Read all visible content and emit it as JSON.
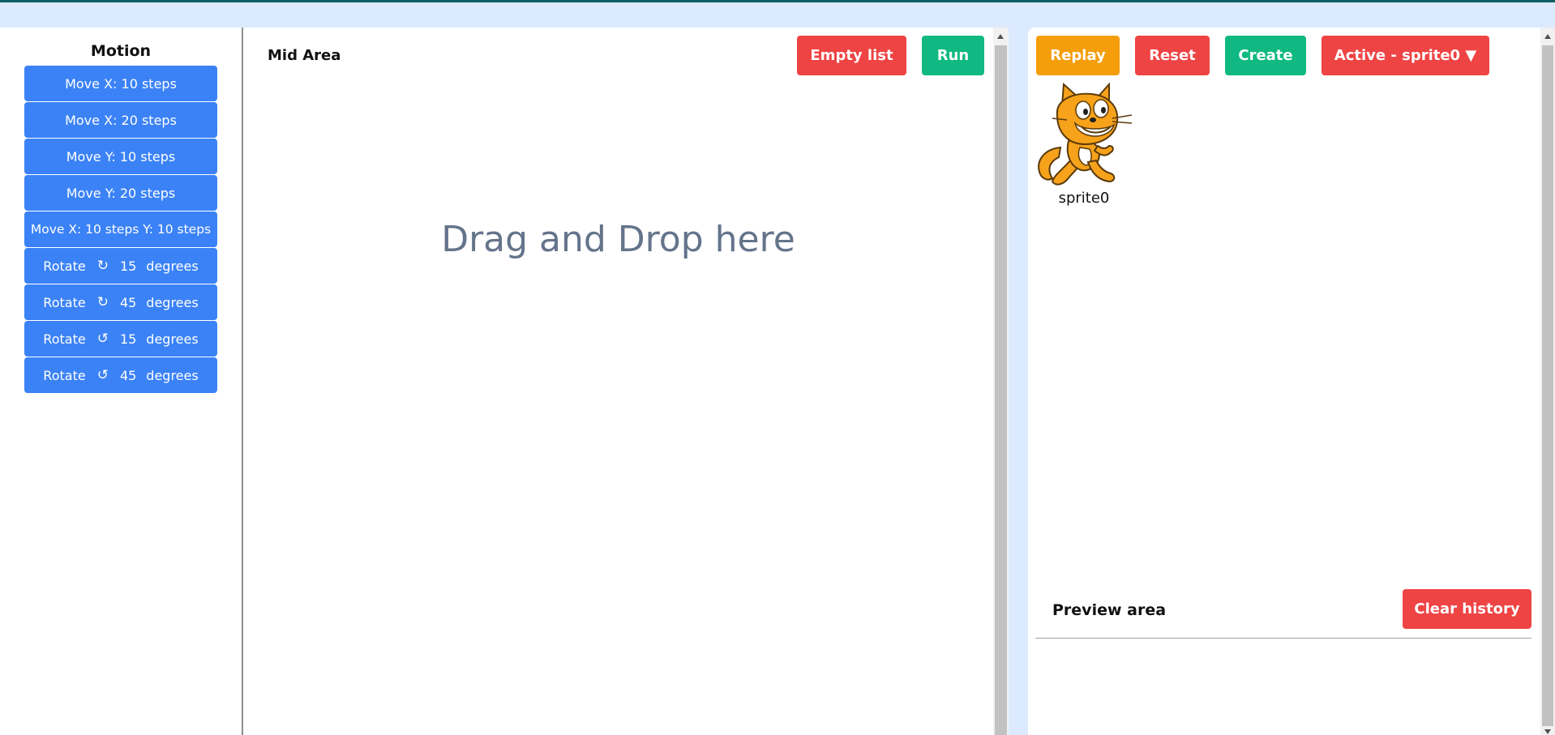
{
  "sidebar": {
    "title": "Motion",
    "blocks": [
      {
        "label": "Move X: 10 steps"
      },
      {
        "label": "Move X: 20 steps"
      },
      {
        "label": "Move Y: 10 steps"
      },
      {
        "label": "Move Y: 20 steps"
      },
      {
        "label": "Move X: 10 steps Y: 10 steps"
      },
      {
        "prefix": "Rotate",
        "icon": "rotate-clockwise-icon",
        "glyph": "↻",
        "value": "15",
        "suffix": "degrees"
      },
      {
        "prefix": "Rotate",
        "icon": "rotate-clockwise-icon",
        "glyph": "↻",
        "value": "45",
        "suffix": "degrees"
      },
      {
        "prefix": "Rotate",
        "icon": "rotate-counterclockwise-icon",
        "glyph": "↺",
        "value": "15",
        "suffix": "degrees"
      },
      {
        "prefix": "Rotate",
        "icon": "rotate-counterclockwise-icon",
        "glyph": "↺",
        "value": "45",
        "suffix": "degrees"
      }
    ]
  },
  "mid": {
    "title": "Mid Area",
    "empty_list_label": "Empty list",
    "run_label": "Run",
    "placeholder": "Drag and Drop here"
  },
  "preview": {
    "replay_label": "Replay",
    "reset_label": "Reset",
    "create_label": "Create",
    "active_sprite_label": "Active - sprite0 ▼",
    "sprite_name": "sprite0",
    "area_title": "Preview area",
    "clear_history_label": "Clear history"
  },
  "colors": {
    "block_blue": "#3b82f6",
    "button_red": "#ef4444",
    "button_green": "#10b981",
    "button_amber": "#f59e0b",
    "page_background": "#dbeafe"
  }
}
